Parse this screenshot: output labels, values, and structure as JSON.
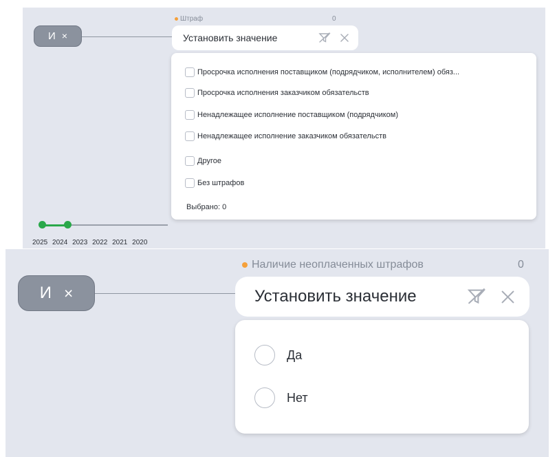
{
  "colors": {
    "background": "#e3e6ee",
    "pill": "#8b929e",
    "accent_dot": "#f5a03a",
    "slider": "#2aa84a"
  },
  "panel1": {
    "operator": {
      "label": "И",
      "remove": "×"
    },
    "field_label": "Штраф",
    "count": "0",
    "input": {
      "value": "Установить значение",
      "icons": [
        "filter-clear-icon",
        "close-icon"
      ]
    },
    "options": [
      "Просрочка исполнения поставщиком (подрядчиком, исполнителем) обяз...",
      "Просрочка исполнения заказчиком обязательств",
      "Ненадлежащее исполнение поставщиком (подрядчиком)",
      "Ненадлежащее исполнение заказчиком обязательств",
      "Другое",
      "Без штрафов"
    ],
    "selected_text": "Выбрано: 0",
    "years": [
      "2025",
      "2024",
      "2023",
      "2022",
      "2021",
      "2020"
    ],
    "selected_years": [
      "2025",
      "2024"
    ]
  },
  "panel2": {
    "operator": {
      "label": "И",
      "remove": "×"
    },
    "field_label": "Наличие неоплаченных штрафов",
    "count": "0",
    "input": {
      "value": "Установить значение",
      "icons": [
        "filter-clear-icon",
        "close-icon"
      ]
    },
    "options": [
      "Да",
      "Нет"
    ]
  }
}
